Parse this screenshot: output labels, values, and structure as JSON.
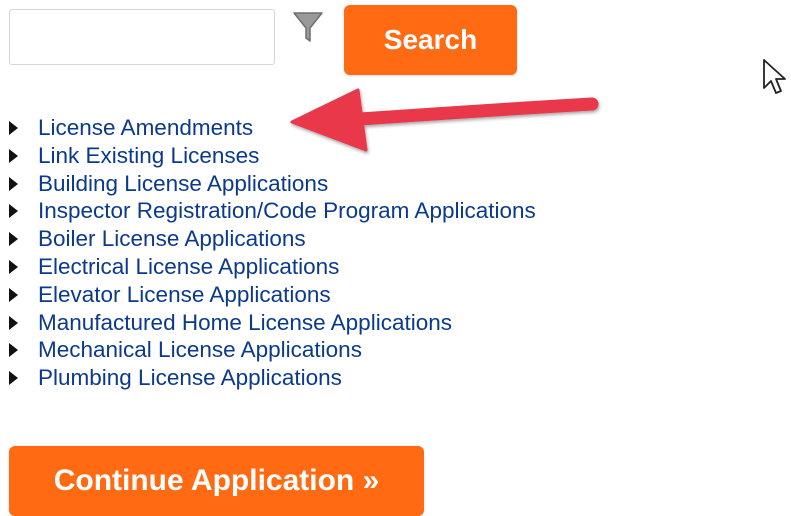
{
  "search": {
    "input_value": "",
    "button_label": "Search"
  },
  "filter": {
    "icon": "funnel-filter-icon"
  },
  "links": [
    "License Amendments",
    "Link Existing Licenses",
    "Building License Applications",
    "Inspector Registration/Code Program Applications",
    "Boiler License Applications",
    "Electrical License Applications",
    "Elevator License Applications",
    "Manufactured Home License Applications",
    "Mechanical License Applications",
    "Plumbing License Applications"
  ],
  "continue_button_label": "Continue Application »",
  "annotation": {
    "arrow_color": "#e8394a",
    "points_to": "License Amendments"
  },
  "colors": {
    "accent_orange": "#ff6a13",
    "link_blue": "#0b3a8c"
  }
}
